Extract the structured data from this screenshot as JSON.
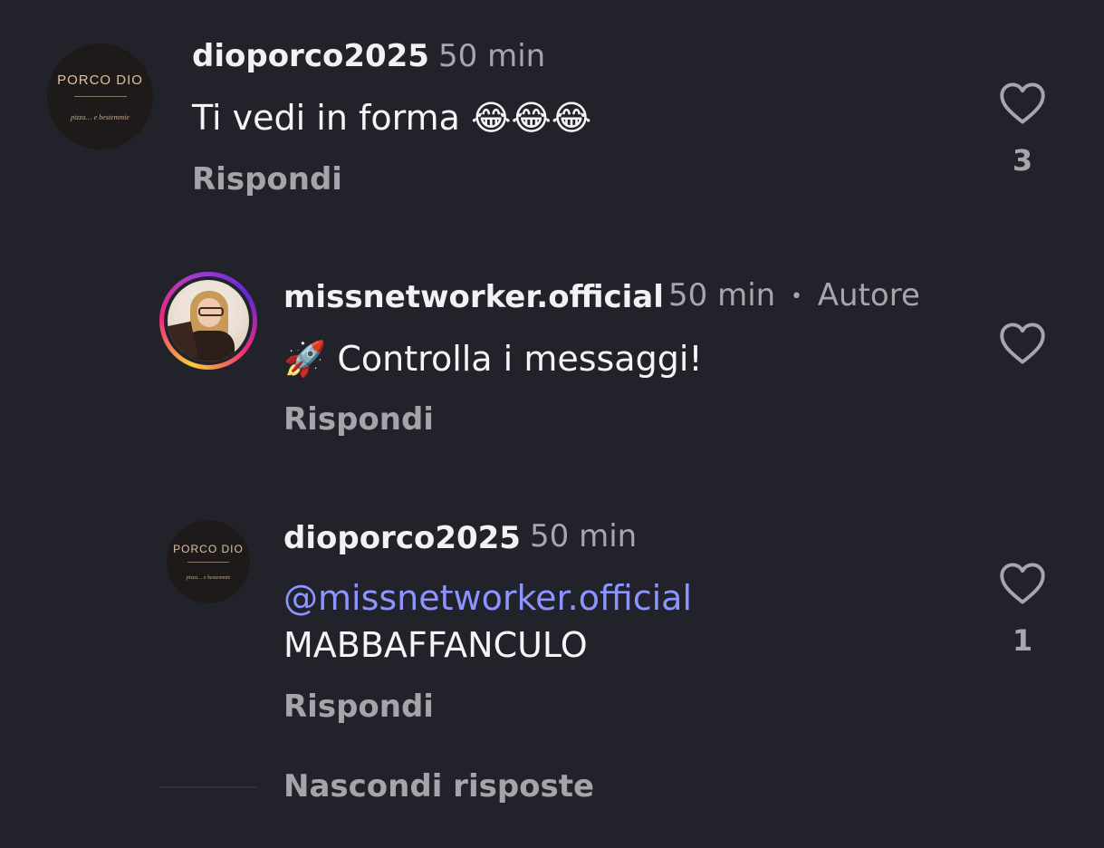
{
  "comments": [
    {
      "avatar": {
        "brand": "PORCO DIO",
        "tagline": "pizza… e bestemmie"
      },
      "username": "dioporco2025",
      "time": "50 min",
      "text": "Ti vedi in forma 😂😂😂",
      "reply_label": "Rispondi",
      "likes": "3"
    },
    {
      "username": "missnetworker.official",
      "time": "50 min",
      "separator": "•",
      "author_badge": "Autore",
      "text": "🚀 Controlla i messaggi!",
      "reply_label": "Rispondi"
    },
    {
      "avatar": {
        "brand": "PORCO DIO",
        "tagline": "pizza… e bestemmie"
      },
      "username": "dioporco2025",
      "time": "50 min",
      "mention": "@missnetworker.official",
      "text": "MABBAFFANCULO",
      "reply_label": "Rispondi",
      "likes": "1"
    }
  ],
  "hide_replies": "Nascondi risposte",
  "colors": {
    "background": "#22232a",
    "mention": "#8c95ff",
    "muted": "#a6a7ad"
  },
  "icons": [
    "heart-outline-icon",
    "threads-at-icon"
  ]
}
